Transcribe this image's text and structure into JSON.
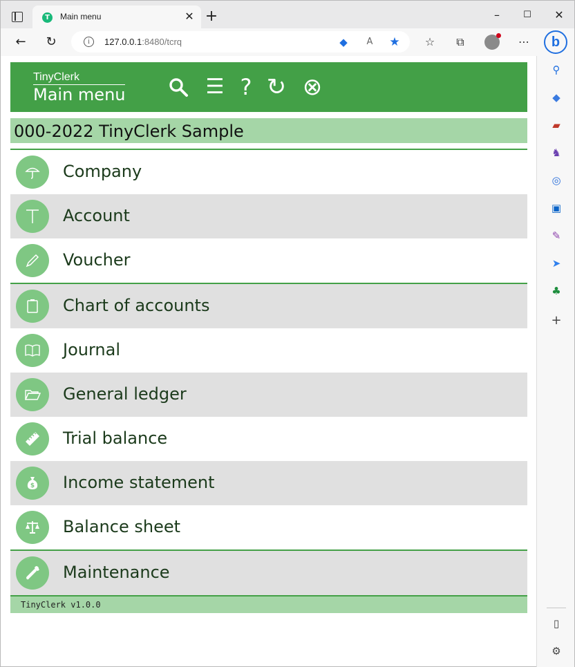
{
  "browser": {
    "tab_title": "Main menu",
    "url_host": "127.0.0.1",
    "url_rest": ":8480/tcrq",
    "new_tab": "+",
    "controls": {
      "minimize": "–",
      "maximize": "☐",
      "close": "✕"
    }
  },
  "app": {
    "brand": "TinyClerk",
    "title": "Main menu",
    "header_buttons": [
      {
        "name": "search",
        "glyph": ""
      },
      {
        "name": "menu",
        "glyph": "☰"
      },
      {
        "name": "help",
        "glyph": "?"
      },
      {
        "name": "refresh",
        "glyph": "↻"
      },
      {
        "name": "close",
        "glyph": "⊗"
      }
    ],
    "company": "000-2022 TinyClerk Sample",
    "menu_items": [
      {
        "label": "Company",
        "icon": "umbrella-icon"
      },
      {
        "label": "Account",
        "icon": "t-account-icon"
      },
      {
        "label": "Voucher",
        "icon": "pencil-icon"
      },
      {
        "label": "Chart of accounts",
        "icon": "clipboard-icon"
      },
      {
        "label": "Journal",
        "icon": "book-icon"
      },
      {
        "label": "General ledger",
        "icon": "folder-open-icon"
      },
      {
        "label": "Trial balance",
        "icon": "ruler-icon"
      },
      {
        "label": "Income statement",
        "icon": "money-bag-icon"
      },
      {
        "label": "Balance sheet",
        "icon": "scales-icon"
      },
      {
        "label": "Maintenance",
        "icon": "wrench-icon"
      }
    ],
    "footer": "TinyClerk v1.0.0"
  },
  "colors": {
    "header_green": "#43a047",
    "light_green": "#a5d6a7",
    "circle_green": "#7fc783",
    "row_gray": "#e0e0e0"
  }
}
